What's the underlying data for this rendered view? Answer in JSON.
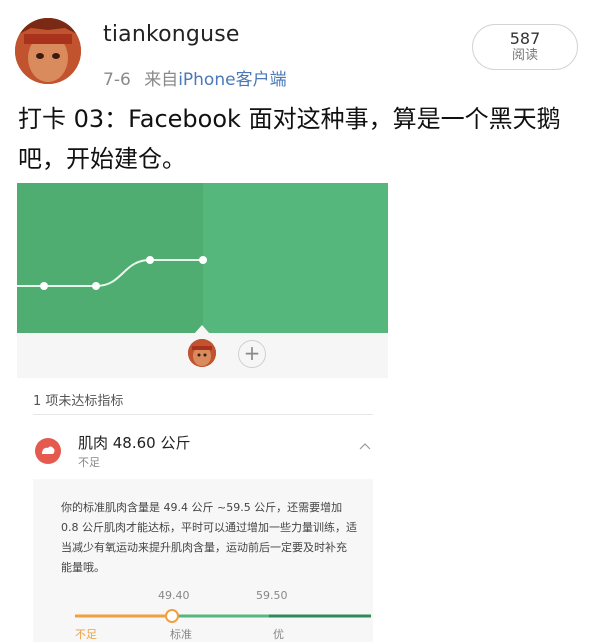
{
  "post": {
    "username": "tiankonguse",
    "date": "7-6",
    "source_prefix": "来自",
    "source_app": "iPhone客户端",
    "read_count": "587",
    "read_label": "阅读",
    "text": "打卡 03：Facebook 面对这种事，算是一个黑天鹅吧，开始建仓。"
  },
  "app_screenshot": {
    "add_symbol": "+",
    "section_title": "1 项未达标指标",
    "metric": {
      "name": "肌肉 48.60 公斤",
      "status": "不足",
      "description": "你的标准肌肉含量是 49.4 公斤 ~59.5 公斤，还需要增加0.8 公斤肌肉才能达标，平时可以通过增加一些力量训练，适当减少有氧运动来提升肌肉含量，运动前后一定要及时补充能量哦。"
    },
    "scale": {
      "low_threshold": "49.40",
      "high_threshold": "59.50",
      "labels": [
        "不足",
        "标准",
        "优"
      ],
      "colors": [
        "#f0a040",
        "#56b77c",
        "#2e8b57"
      ]
    }
  },
  "chart_data": {
    "type": "line",
    "x": [
      1,
      2,
      3,
      4
    ],
    "values": [
      1,
      1,
      2,
      2
    ],
    "grid": false
  }
}
